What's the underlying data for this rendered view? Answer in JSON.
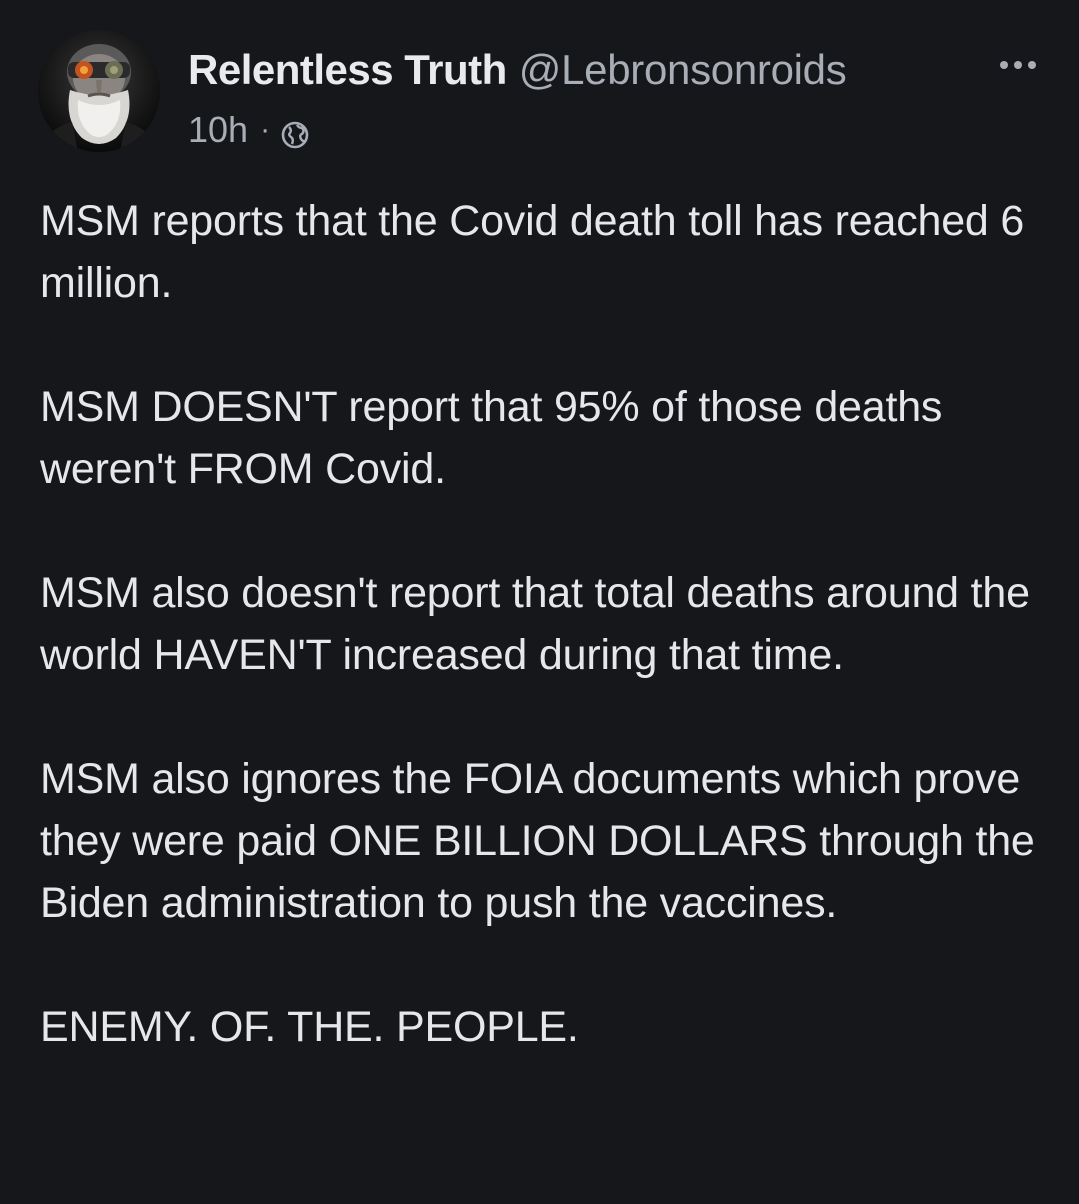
{
  "post": {
    "author": {
      "display_name": "Relentless Truth",
      "handle": "@Lebronsonroids",
      "avatar_icon": "avatar-bearded-man-sunglasses"
    },
    "time_ago": "10h",
    "separator": "·",
    "visibility_icon": "globe-icon",
    "more_icon": "more-options-icon",
    "paragraphs": [
      "MSM reports that the Covid death toll has reached 6 million.",
      "MSM DOESN'T report that 95% of those deaths weren't FROM Covid.",
      "MSM also doesn't report that total deaths around the world HAVEN'T increased during that time.",
      "MSM also ignores the FOIA documents which prove they were paid ONE BILLION DOLLARS through the Biden administration to push the vaccines.",
      "ENEMY. OF. THE. PEOPLE."
    ]
  },
  "colors": {
    "background": "#15171b",
    "text_primary": "#e6e7ea",
    "text_secondary": "#a9adb5"
  }
}
